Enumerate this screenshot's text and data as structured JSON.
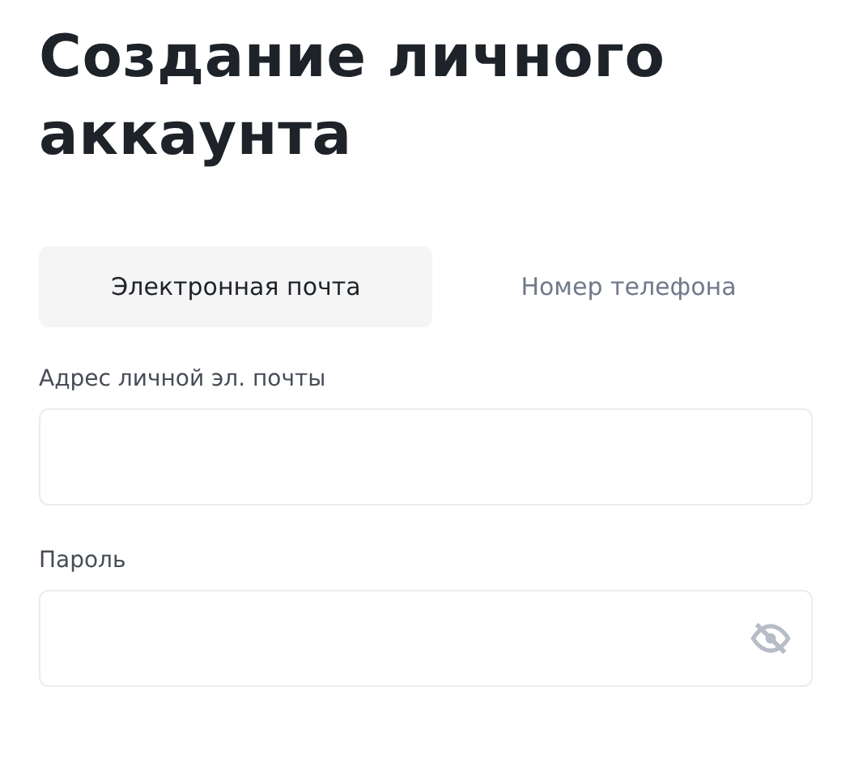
{
  "title": "Создание личного аккаунта",
  "tabs": [
    {
      "label": "Электронная почта",
      "selected": true
    },
    {
      "label": "Номер телефона",
      "selected": false
    }
  ],
  "fields": [
    {
      "label": "Адрес личной эл. почты",
      "kind": "text"
    },
    {
      "label": "Пароль",
      "kind": "password"
    }
  ]
}
